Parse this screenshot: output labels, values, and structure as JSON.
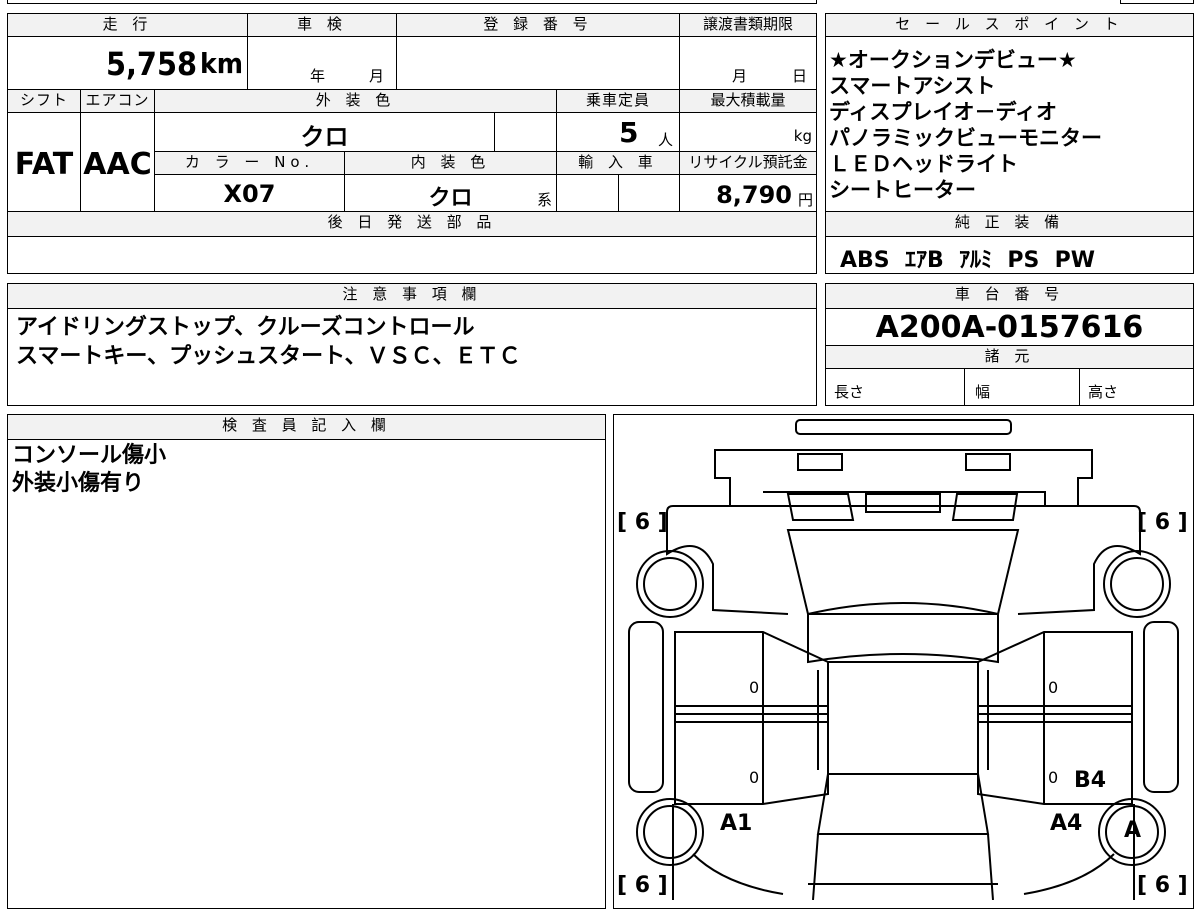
{
  "vehicle": {
    "mileage_label": "走 行",
    "mileage_value": "5,758",
    "mileage_unit": "km",
    "inspection_label": "車 検",
    "inspection_year": "年",
    "inspection_month": "月",
    "registration_label": "登 録 番 号",
    "transfer_deadline_label": "譲渡書類期限",
    "transfer_month": "月",
    "transfer_day": "日",
    "shift_label": "シフト",
    "shift_value": "FAT",
    "aircon_label": "エアコン",
    "aircon_value": "AAC",
    "exterior_color_label": "外 装 色",
    "exterior_color_value": "クロ",
    "capacity_label": "乗車定員",
    "capacity_value": "5",
    "capacity_unit": "人",
    "max_load_label": "最大積載量",
    "max_load_unit": "kg",
    "color_no_label": "カ ラ ー No.",
    "color_no_value": "X07",
    "interior_color_label": "内 装 色",
    "interior_color_value": "クロ",
    "interior_color_suffix": "系",
    "import_label": "輸 入 車",
    "recycle_label": "リサイクル預託金",
    "recycle_value": "8,790",
    "recycle_unit": "円",
    "later_parts_label": "後 日 発 送 部 品"
  },
  "sales_points": {
    "label": "セ ー ル ス ポ イ ン ト",
    "items": [
      "★オークションデビュー★",
      "スマートアシスト",
      "ディスプレイオ－ディオ",
      "パノラミックビューモニター",
      "ＬＥＤヘッドライト",
      "シートヒーター"
    ]
  },
  "equipment": {
    "label": "純 正 装 備",
    "values": "ABS  ｴｱB  ｱﾙﾐ  PS  PW"
  },
  "notes": {
    "label": "注 意 事 項 欄",
    "lines": [
      "アイドリングストップ、クルーズコントロール",
      "スマートキー、プッシュスタート、ＶＳＣ、ＥＴＣ"
    ]
  },
  "chassis": {
    "label": "車 台 番 号",
    "value": "A200A-0157616"
  },
  "specs": {
    "label": "諸 元",
    "length": "長さ",
    "width": "幅",
    "height": "高さ"
  },
  "inspector": {
    "label": "検 査 員 記 入 欄",
    "lines": [
      "コンソール傷小",
      "外装小傷有り"
    ]
  },
  "diagram": {
    "tire_tl": "[ 6 ]",
    "tire_tr": "[ 6 ]",
    "tire_bl": "[ 6 ]",
    "tire_br": "[ 6 ]",
    "zero_1": "0",
    "zero_2": "0",
    "zero_3": "0",
    "zero_4": "0",
    "mark_a1": "A1",
    "mark_a4": "A4",
    "mark_b4": "B4",
    "mark_a": "A"
  }
}
